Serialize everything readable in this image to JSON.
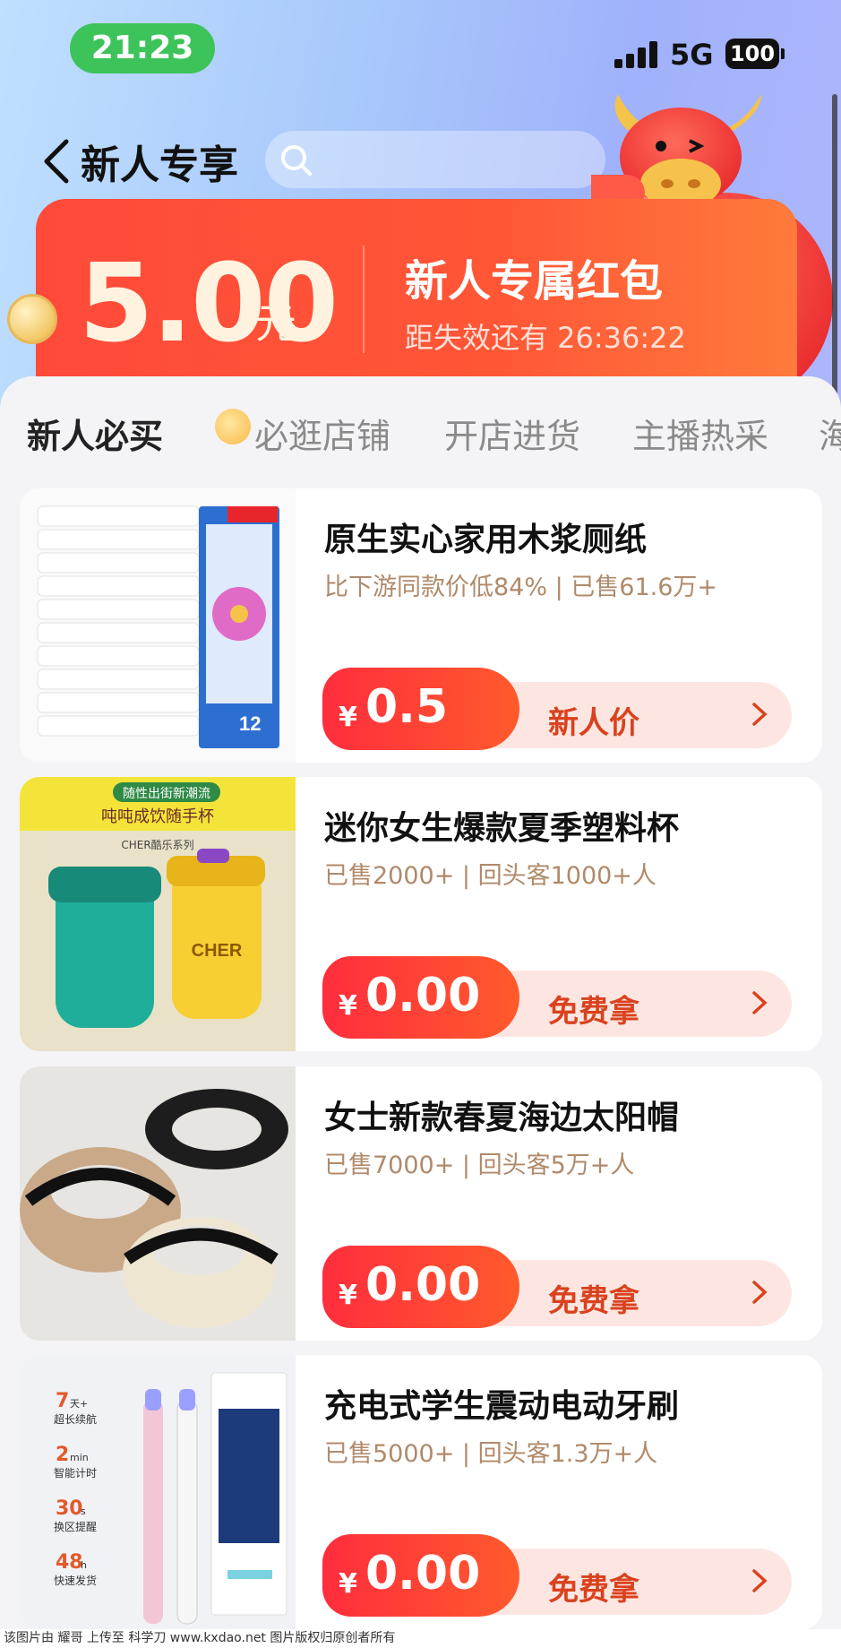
{
  "status_bar": {
    "time": "21:23",
    "network": "5G",
    "battery": "100"
  },
  "header": {
    "title": "新人专享",
    "search_placeholder": ""
  },
  "red_packet": {
    "amount": "5.00",
    "unit": "元",
    "title": "新人专属红包",
    "countdown": "距失效还有 26:36:22"
  },
  "tabs": [
    {
      "label": "新人必买"
    },
    {
      "label": "必逛店铺"
    },
    {
      "label": "开店进货"
    },
    {
      "label": "主播热采"
    },
    {
      "label": "海"
    }
  ],
  "products": [
    {
      "title": "原生实心家用木浆厕纸",
      "stats": "比下游同款价低84% | 已售61.6万+",
      "currency": "¥",
      "price": "0.5",
      "action": "新人价",
      "image_label": "12"
    },
    {
      "title": "迷你女生爆款夏季塑料杯",
      "stats": "已售2000+ | 回头客1000+人",
      "currency": "¥",
      "price": "0.00",
      "action": "免费拿",
      "image_banner": "随性出街新潮流",
      "image_sub": "吨吨成饮随手杯",
      "image_brand": "CHER酷乐系列",
      "image_logo": "CHER"
    },
    {
      "title": "女士新款春夏海边太阳帽",
      "stats": "已售7000+ | 回头客5万+人",
      "currency": "¥",
      "price": "0.00",
      "action": "免费拿"
    },
    {
      "title": "充电式学生震动电动牙刷",
      "stats": "已售5000+ | 回头客1.3万+人",
      "currency": "¥",
      "price": "0.00",
      "action": "免费拿",
      "image_features": [
        {
          "num": "7",
          "unit": "天+",
          "text": "超长续航"
        },
        {
          "num": "2",
          "unit": "min",
          "text": "智能计时"
        },
        {
          "num": "30",
          "unit": "s",
          "text": "换区提醒"
        },
        {
          "num": "48",
          "unit": "h",
          "text": "快速发货"
        }
      ]
    }
  ],
  "watermark": "该图片由 耀哥 上传至 科学刀 www.kxdao.net 图片版权归原创者所有",
  "colors": {
    "accent_red": "#ff3a32",
    "price_pill": "#fde6e1",
    "status_green": "#3cc35a"
  },
  "icons": [
    "back-chevron-icon",
    "search-icon",
    "signal-icon",
    "chevron-right-icon",
    "emoji-icon"
  ]
}
